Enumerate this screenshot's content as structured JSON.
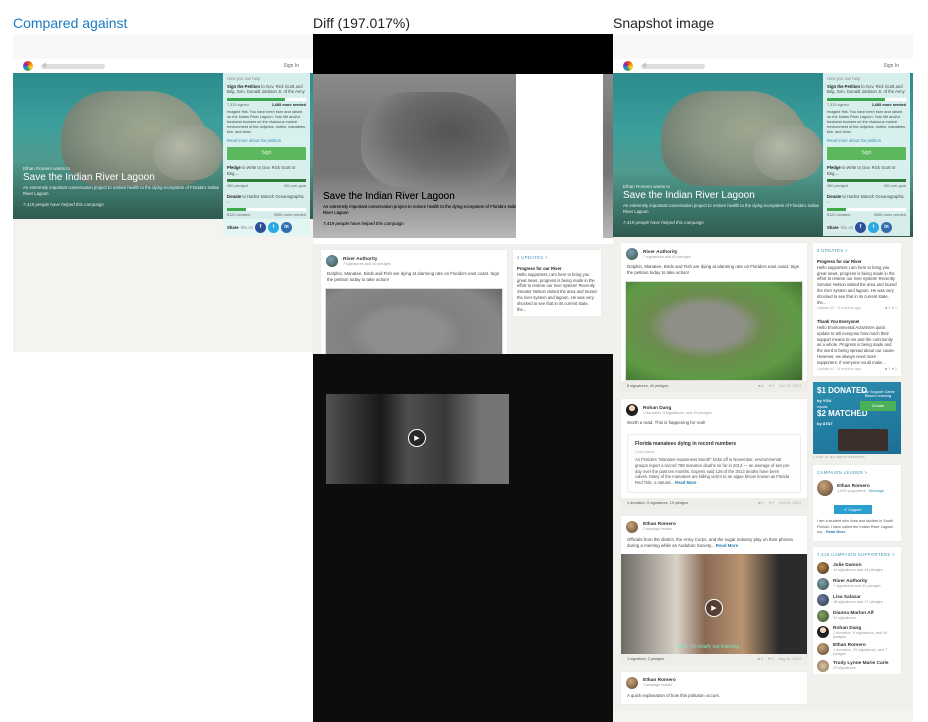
{
  "columns": {
    "compared": "Compared against",
    "diff": "Diff (197.017%)",
    "snapshot": "Snapshot image"
  },
  "page": {
    "nav": {
      "sign_in": "Sign In",
      "search_icon": "magnifier-icon",
      "logo_icon": "rainbow-logo-icon"
    },
    "hero": {
      "kicker": "Ethan Romero wants to",
      "title": "Save the Indian River Lagoon",
      "description": "An extremely important conservation project to restore health to the dying ecosystem of Florida's Indian River Lagoon",
      "helped": "7,419 people have helped this campaign"
    },
    "help": {
      "heading": "How you can help",
      "petition": {
        "label": "Sign the Petition",
        "target": "to Gov. Rick Scott and Brig. Gen. Donald Jackson Jr. of the Army",
        "signed": "7,315 signed",
        "needed": "2,685 more needed",
        "progress": 0.73,
        "body": "Imagine this: You have been born and raised on the Indian River Lagoon. Your life and/or business focuses on the vivacious marine environment of the dolphins, turtles, manatees, fish, and other",
        "read_more": "Read more about the petition",
        "sign_button": "Sign"
      },
      "pledge": {
        "label": "Pledge",
        "target": "to Write to Gov. Rick Scott or Brig....",
        "pledged": "580 pledged",
        "over_goal": "+80 over goal",
        "progress": 1.0
      },
      "donate": {
        "label": "Donate",
        "target": "to Harbor Branch Oceanographic ...",
        "donated": "$120 donated",
        "needed": "$380 more needed",
        "progress": 0.24
      },
      "share": {
        "label": "Share",
        "suffix": "this on",
        "facebook": "f",
        "twitter": "t",
        "linkedin": "in"
      }
    },
    "feed": [
      {
        "author": "River Authority",
        "meta": "7 signatures and 40 pledges",
        "text": "Dolphin, Manatee, Birds and Fish are dying at alarming rate on Florida's east coast. Sign the petition today to take action!",
        "footer": "8 signatures, 40 pledges",
        "comments": "0",
        "likes": "2",
        "date": "Oct 23, 2013"
      },
      {
        "author": "Rohan Dang",
        "meta": "1 donation, 9 signatures, and 19 pledges",
        "text": "Worth a read. This is happening for real!",
        "article_title": "Florida manatees dying in record numbers",
        "article_source": "Cnca News",
        "article_body": "As Florida's \"Manatee Awareness Month\" kicks off in November, environmental groups report a record 769 manatee deaths so far in 2013 — an average of two per day over the past ten months. Experts said 126 of the 2013 deaths have been calves. Many of the manatees are falling victim to an algae bloom known as Florida Red Tide, a natural...",
        "read_more": "Read More",
        "footer": "1 donation, 9 signatures, 19 pledges",
        "comments": "1",
        "likes": "4",
        "date": "Oct 31, 2013"
      },
      {
        "author": "Ethan Romero",
        "meta": "Campaign leader",
        "text": "Officials from the district, the Army Corps, and the sugar industry play on their phones during a meeting while an Audubon Society...",
        "read_more": "Read More",
        "video_caption": "Yeah, I'm totally not listening",
        "footer": "1 signature, 2 pledges",
        "comments": "1",
        "likes": "2",
        "date": "Aug 16, 2013"
      },
      {
        "author": "Ethan Romero",
        "meta": "Campaign leader",
        "text": "A quick explanation of how this pollution occurs."
      }
    ],
    "updates": {
      "title": "2 UPDATES >",
      "items": [
        {
          "title": "Progress for our River",
          "body": "Hello supporters,I am here to bring you great news, progress is being made in the effort to restore our river system! Recently Senator Nelson visited the area and toured the river system and lagoon. He was very shocked to see that in its current state, the...",
          "meta": "Update #2 · 6 months ago",
          "comments": "2",
          "likes": "1"
        },
        {
          "title": "Thank You Everyone!",
          "body": "Hello Environmental Activists!A quick update to tell everyone how much their support means to me and the community as a whole. Progress is being made and the word is being spread about our cause. However, we always need more supporters. If everyone could make...",
          "meta": "Update #1 · 6 months ago",
          "comments": "1",
          "likes": "2"
        }
      ]
    },
    "ad": {
      "line1": "$1 DONATED",
      "line1b": "by YOU",
      "equals": "equals",
      "line2": "$2 MATCHED",
      "line2b": "by AT&T",
      "headline": "Help Support Game Based Learning",
      "button": "Donate",
      "note": "• this is an advertisement"
    },
    "leader": {
      "title": "CAMPAIGN LEADER >",
      "name": "Ethan Romero",
      "supporters": "1,045 supporters",
      "message": "Message",
      "support_button": "Support",
      "bio": "I am a student who lives and studies in South Florida. I have called the Indian River Lagoon my...",
      "read_more": "Read More"
    },
    "supporters": {
      "title": "7,419 CAMPAIGN SUPPORTERS >",
      "items": [
        {
          "name": "Julie Damon",
          "meta": "44 signatures and 44 pledges"
        },
        {
          "name": "River Authority",
          "meta": "7 signatures and 40 pledges"
        },
        {
          "name": "Lisa Salazar",
          "meta": "18 signatures and 17 pledges"
        },
        {
          "name": "Dianna Marlon Alf",
          "meta": "31 signatures"
        },
        {
          "name": "Rohan Dang",
          "meta": "1 donation, 9 signatures, and 19 pledges"
        },
        {
          "name": "Ethan Romero",
          "meta": "1 donation, 20 signatures, and 7 pledges"
        },
        {
          "name": "Trudy Lynne Marie Carle",
          "meta": "23 signatures"
        }
      ]
    }
  }
}
